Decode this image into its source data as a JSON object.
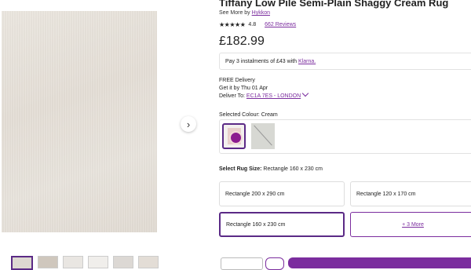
{
  "product": {
    "title": "Tiffany Low Pile Semi-Plain Shaggy Cream Rug",
    "see_more_prefix": "See More by",
    "brand": "Hykkon",
    "stars": "★★★★★",
    "rating": "4.8",
    "reviews": "662 Reviews",
    "price": "£182.99"
  },
  "klarna": {
    "text": "Pay 3 instalments of £43 with",
    "link": "Klarna."
  },
  "delivery": {
    "line1": "FREE Delivery",
    "line2": "Get it by Thu 01 Apr",
    "deliver_to": "Deliver To:",
    "location": "EC1A 7ES - LONDON"
  },
  "colour": {
    "label": "Selected Colour: Cream"
  },
  "size": {
    "label_prefix": "Select Rug Size:",
    "label_value": "Rectangle 160 x 230 cm",
    "options": [
      "Rectangle 200 x 290 cm",
      "Rectangle 120 x 170 cm",
      "Rectangle 160 x 230 cm",
      "+ 3 More"
    ]
  },
  "icons": {
    "next": "chevron-right-icon"
  }
}
